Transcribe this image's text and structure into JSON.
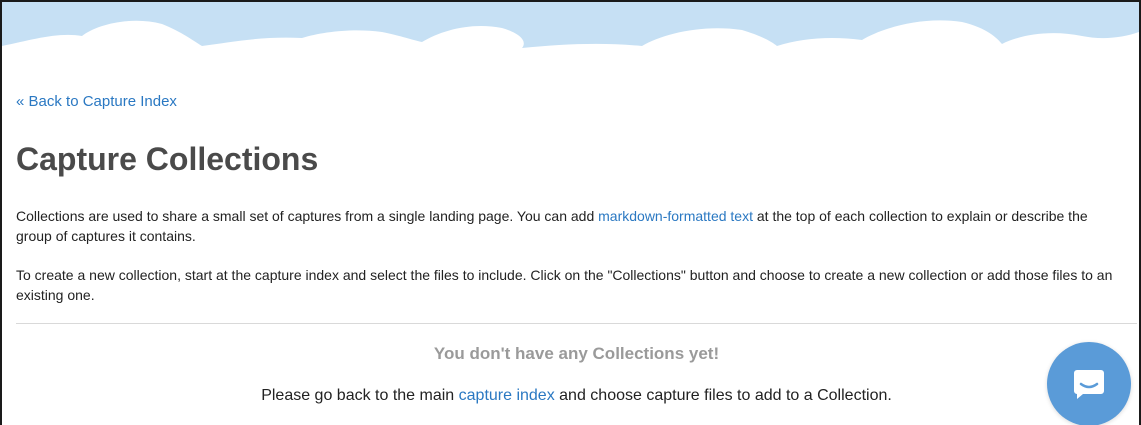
{
  "nav": {
    "back_link": "« Back to Capture Index"
  },
  "page": {
    "title": "Capture Collections",
    "intro": {
      "before_link": "Collections are used to share a small set of captures from a single landing page. You can add ",
      "link_text": "markdown-formatted text",
      "after_link": " at the top of each collection to explain or describe the group of captures it contains."
    },
    "instructions": "To create a new collection, start at the capture index and select the files to include. Click on the \"Collections\" button and choose to create a new collection or add those files to an existing one."
  },
  "empty_state": {
    "title": "You don't have any Collections yet!",
    "before_link": "Please go back to the main ",
    "link_text": "capture index",
    "after_link": " and choose capture files to add to a Collection."
  },
  "chat_widget": {
    "icon": "chat-bubble-icon",
    "color": "#5a9bd8"
  },
  "theme": {
    "link_color": "#2a78c2",
    "sky_color": "#c6e0f4"
  }
}
